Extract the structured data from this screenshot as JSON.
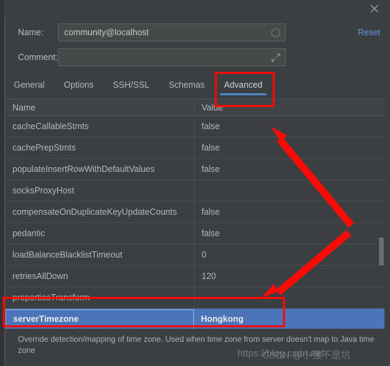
{
  "window": {
    "title": "",
    "close_icon": "close-icon"
  },
  "form": {
    "name_label": "Name:",
    "name_value": "community@localhost",
    "name_adornment_icon": "refresh-circle-icon",
    "comment_label": "Comment:",
    "comment_value": "",
    "comment_placeholder": "",
    "comment_adornment_icon": "expand-arrow-icon",
    "reset_label": "Reset"
  },
  "tabs": [
    {
      "label": "General",
      "active": false
    },
    {
      "label": "Options",
      "active": false
    },
    {
      "label": "SSH/SSL",
      "active": false
    },
    {
      "label": "Schemas",
      "active": false
    },
    {
      "label": "Advanced",
      "active": true
    }
  ],
  "table": {
    "columns": [
      "Name",
      "Value"
    ],
    "rows": [
      {
        "name": "cacheCallableStmts",
        "value": "false",
        "selected": false
      },
      {
        "name": "cachePrepStmts",
        "value": "false",
        "selected": false
      },
      {
        "name": "populateInsertRowWithDefaultValues",
        "value": "false",
        "selected": false
      },
      {
        "name": "socksProxyHost",
        "value": "",
        "selected": false
      },
      {
        "name": "compensateOnDuplicateKeyUpdateCounts",
        "value": "false",
        "selected": false
      },
      {
        "name": "pedantic",
        "value": "false",
        "selected": false
      },
      {
        "name": "loadBalanceBlacklistTimeout",
        "value": "0",
        "selected": false
      },
      {
        "name": "retriesAllDown",
        "value": "120",
        "selected": false
      },
      {
        "name": "propertiesTransform",
        "value": "",
        "selected": false
      },
      {
        "name": "serverTimezone",
        "value": "Hongkong",
        "selected": true
      }
    ]
  },
  "description": "Override detection/mapping of time zone. Used when time zone from server doesn't map to Java time zone",
  "watermarks": [
    "https://blog.csdn.net",
    "CSDN @小强不是坑"
  ],
  "colors": {
    "background": "#3c3f41",
    "selection_blue": "#4b75b8",
    "focus_border": "#8cb6e8",
    "accent_underline": "#4a88c7",
    "link": "#5a9ae0",
    "annotation_red": "#fb0b06",
    "text": "#b6b6b6"
  }
}
